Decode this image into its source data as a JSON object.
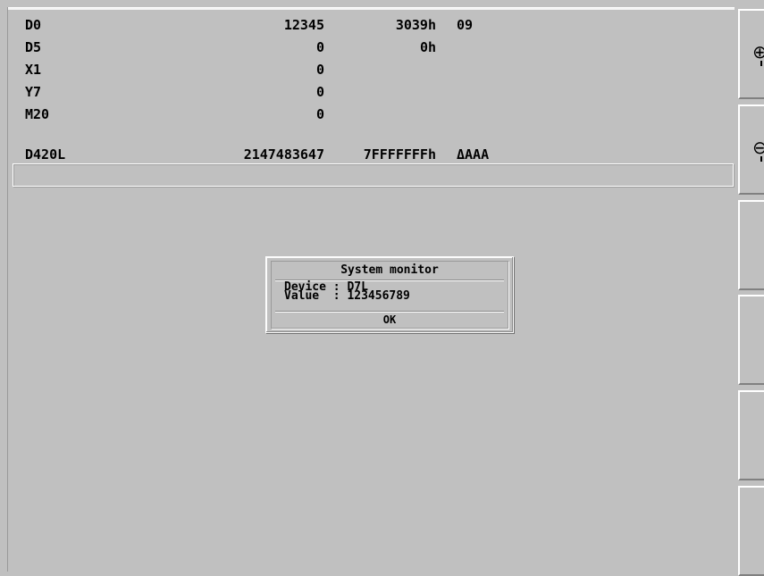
{
  "monitor": {
    "rows": [
      {
        "device": "D0",
        "decimal": "12345",
        "hex": "3039h",
        "ascii": "09"
      },
      {
        "device": "D5",
        "decimal": "0",
        "hex": "0h",
        "ascii": ""
      },
      {
        "device": "X1",
        "decimal": "0",
        "hex": "",
        "ascii": ""
      },
      {
        "device": "Y7",
        "decimal": "0",
        "hex": "",
        "ascii": ""
      },
      {
        "device": "M20",
        "decimal": "0",
        "hex": "",
        "ascii": ""
      },
      {
        "device": "D420L",
        "decimal": "2147483647",
        "hex": "7FFFFFFFh",
        "ascii": "ΔAAA"
      }
    ],
    "entry_value": ""
  },
  "side_buttons": {
    "zoom_in_glyph": "⊕",
    "zoom_out_glyph": "⊖"
  },
  "dialog": {
    "title": "System monitor",
    "device_line": "Device : D7L",
    "value_line": "Value  : 123456789",
    "ok_label": "OK"
  }
}
